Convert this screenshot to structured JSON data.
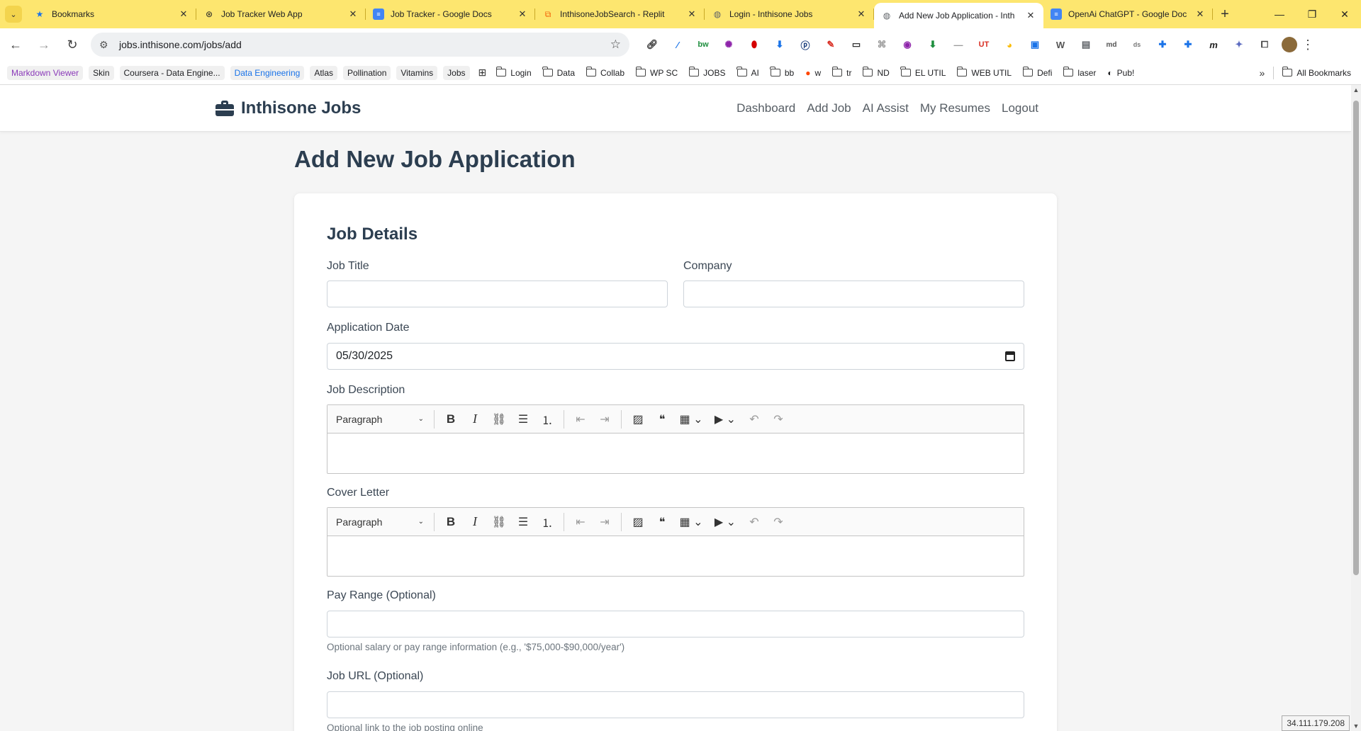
{
  "browser": {
    "tabs": [
      {
        "title": "Bookmarks",
        "favicon": "star-icon",
        "color": "#1a73e8"
      },
      {
        "title": "Job Tracker Web App",
        "favicon": "chatgpt-icon",
        "color": "#202124"
      },
      {
        "title": "Job Tracker - Google Docs",
        "favicon": "docs-icon",
        "color": "#4285f4"
      },
      {
        "title": "InthisoneJobSearch - Replit",
        "favicon": "replit-icon",
        "color": "#f26207"
      },
      {
        "title": "Login - Inthisone Jobs",
        "favicon": "globe-icon",
        "color": "#5f6368"
      },
      {
        "title": "Add New Job Application - Inth",
        "favicon": "globe-icon",
        "color": "#5f6368",
        "active": true
      },
      {
        "title": "OpenAi ChatGPT - Google Doc",
        "favicon": "docs-icon",
        "color": "#4285f4"
      }
    ],
    "url": "jobs.inthisone.com/jobs/add",
    "bookmarks": {
      "pills": [
        "Markdown Viewer",
        "Skin",
        "Coursera - Data Engine...",
        "Data Engineering",
        "Atlas",
        "Pollination",
        "Vitamins",
        "Jobs"
      ],
      "pill_colors": [
        "#8a3ab9",
        "#202124",
        "#202124",
        "#1a73e8",
        "#202124",
        "#202124",
        "#202124",
        "#202124"
      ],
      "folders": [
        "Login",
        "Data",
        "Collab",
        "WP SC",
        "JOBS",
        "AI",
        "bb"
      ],
      "w_label": "w",
      "folders2": [
        "tr",
        "ND",
        "EL UTIL",
        "WEB UTIL",
        "Defi",
        "laser"
      ],
      "pub_label": "Pub!",
      "all_bookmarks": "All Bookmarks"
    }
  },
  "site": {
    "brand": "Inthisone Jobs",
    "nav": [
      "Dashboard",
      "Add Job",
      "AI Assist",
      "My Resumes",
      "Logout"
    ]
  },
  "form": {
    "page_title": "Add New Job Application",
    "section_title": "Job Details",
    "job_title_label": "Job Title",
    "company_label": "Company",
    "application_date_label": "Application Date",
    "application_date_value": "05/30/2025",
    "job_description_label": "Job Description",
    "cover_letter_label": "Cover Letter",
    "editor_paragraph": "Paragraph",
    "pay_range_label": "Pay Range (Optional)",
    "pay_range_help": "Optional salary or pay range information (e.g., '$75,000-$90,000/year')",
    "job_url_label": "Job URL (Optional)",
    "job_url_help": "Optional link to the job posting online"
  },
  "status": {
    "ip": "34.111.179.208"
  }
}
